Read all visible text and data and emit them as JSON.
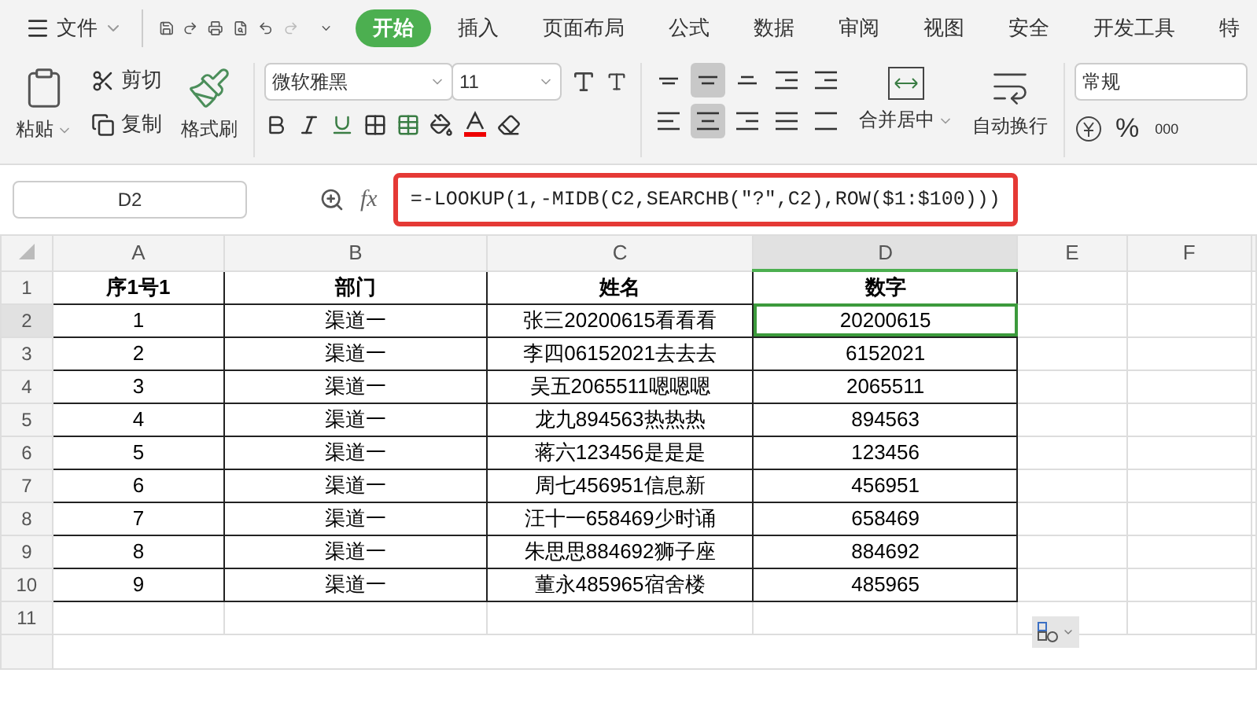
{
  "menu_bar": {
    "file_menu": "文件",
    "tabs": [
      {
        "label": "开始",
        "selected": true
      },
      {
        "label": "插入",
        "selected": false
      },
      {
        "label": "页面布局",
        "selected": false
      },
      {
        "label": "公式",
        "selected": false
      },
      {
        "label": "数据",
        "selected": false
      },
      {
        "label": "审阅",
        "selected": false
      },
      {
        "label": "视图",
        "selected": false
      },
      {
        "label": "安全",
        "selected": false
      },
      {
        "label": "开发工具",
        "selected": false
      },
      {
        "label": "特",
        "selected": false
      }
    ]
  },
  "ribbon": {
    "paste": "粘贴",
    "cut": "剪切",
    "copy": "复制",
    "format_painter": "格式刷",
    "font_name": "微软雅黑",
    "font_size": "11",
    "align_buttons": [
      {
        "kind": "top",
        "selected": false
      },
      {
        "kind": "middle",
        "selected": true
      },
      {
        "kind": "bottom",
        "selected": false
      },
      {
        "kind": "outdent",
        "selected": false
      },
      {
        "kind": "indent",
        "selected": false
      },
      {
        "kind": "left",
        "selected": false
      },
      {
        "kind": "center",
        "selected": true
      },
      {
        "kind": "right",
        "selected": false
      },
      {
        "kind": "justify",
        "selected": false
      },
      {
        "kind": "distribute",
        "selected": false
      }
    ],
    "merge": "合并居中",
    "wrap": "自动换行",
    "number_format": "常规",
    "percent": "%",
    "thousands": "000"
  },
  "formula_bar": {
    "name_box": "D2",
    "fx": "fx",
    "formula": "=-LOOKUP(1,-MIDB(C2,SEARCHB(\"?\",C2),ROW($1:$100)))"
  },
  "sheet": {
    "columns": [
      {
        "label": "A",
        "selected": false
      },
      {
        "label": "B",
        "selected": false
      },
      {
        "label": "C",
        "selected": false
      },
      {
        "label": "D",
        "selected": true
      },
      {
        "label": "E",
        "selected": false
      },
      {
        "label": "F",
        "selected": false
      }
    ],
    "rows": [
      {
        "number": "1",
        "kind": "header",
        "selected": false,
        "cells": [
          "序1号1",
          "部门",
          "姓名",
          "数字"
        ]
      },
      {
        "number": "2",
        "kind": "data",
        "selected": true,
        "cells": [
          "1",
          "渠道一",
          "张三20200615看看看",
          "20200615"
        ]
      },
      {
        "number": "3",
        "kind": "data",
        "selected": false,
        "cells": [
          "2",
          "渠道一",
          "李四06152021去去去",
          "6152021"
        ]
      },
      {
        "number": "4",
        "kind": "data",
        "selected": false,
        "cells": [
          "3",
          "渠道一",
          "吴五2065511嗯嗯嗯",
          "2065511"
        ]
      },
      {
        "number": "5",
        "kind": "data",
        "selected": false,
        "cells": [
          "4",
          "渠道一",
          "龙九894563热热热",
          "894563"
        ]
      },
      {
        "number": "6",
        "kind": "data",
        "selected": false,
        "cells": [
          "5",
          "渠道一",
          "蒋六123456是是是",
          "123456"
        ]
      },
      {
        "number": "7",
        "kind": "data",
        "selected": false,
        "cells": [
          "6",
          "渠道一",
          "周七456951信息新",
          "456951"
        ]
      },
      {
        "number": "8",
        "kind": "data",
        "selected": false,
        "cells": [
          "7",
          "渠道一",
          "汪十一658469少时诵",
          "658469"
        ]
      },
      {
        "number": "9",
        "kind": "data",
        "selected": false,
        "cells": [
          "8",
          "渠道一",
          "朱思思884692狮子座",
          "884692"
        ]
      },
      {
        "number": "10",
        "kind": "data",
        "selected": false,
        "cells": [
          "9",
          "渠道一",
          "董永485965宿舍楼",
          "485965"
        ]
      },
      {
        "number": "11",
        "kind": "empty",
        "selected": false,
        "cells": []
      }
    ]
  }
}
